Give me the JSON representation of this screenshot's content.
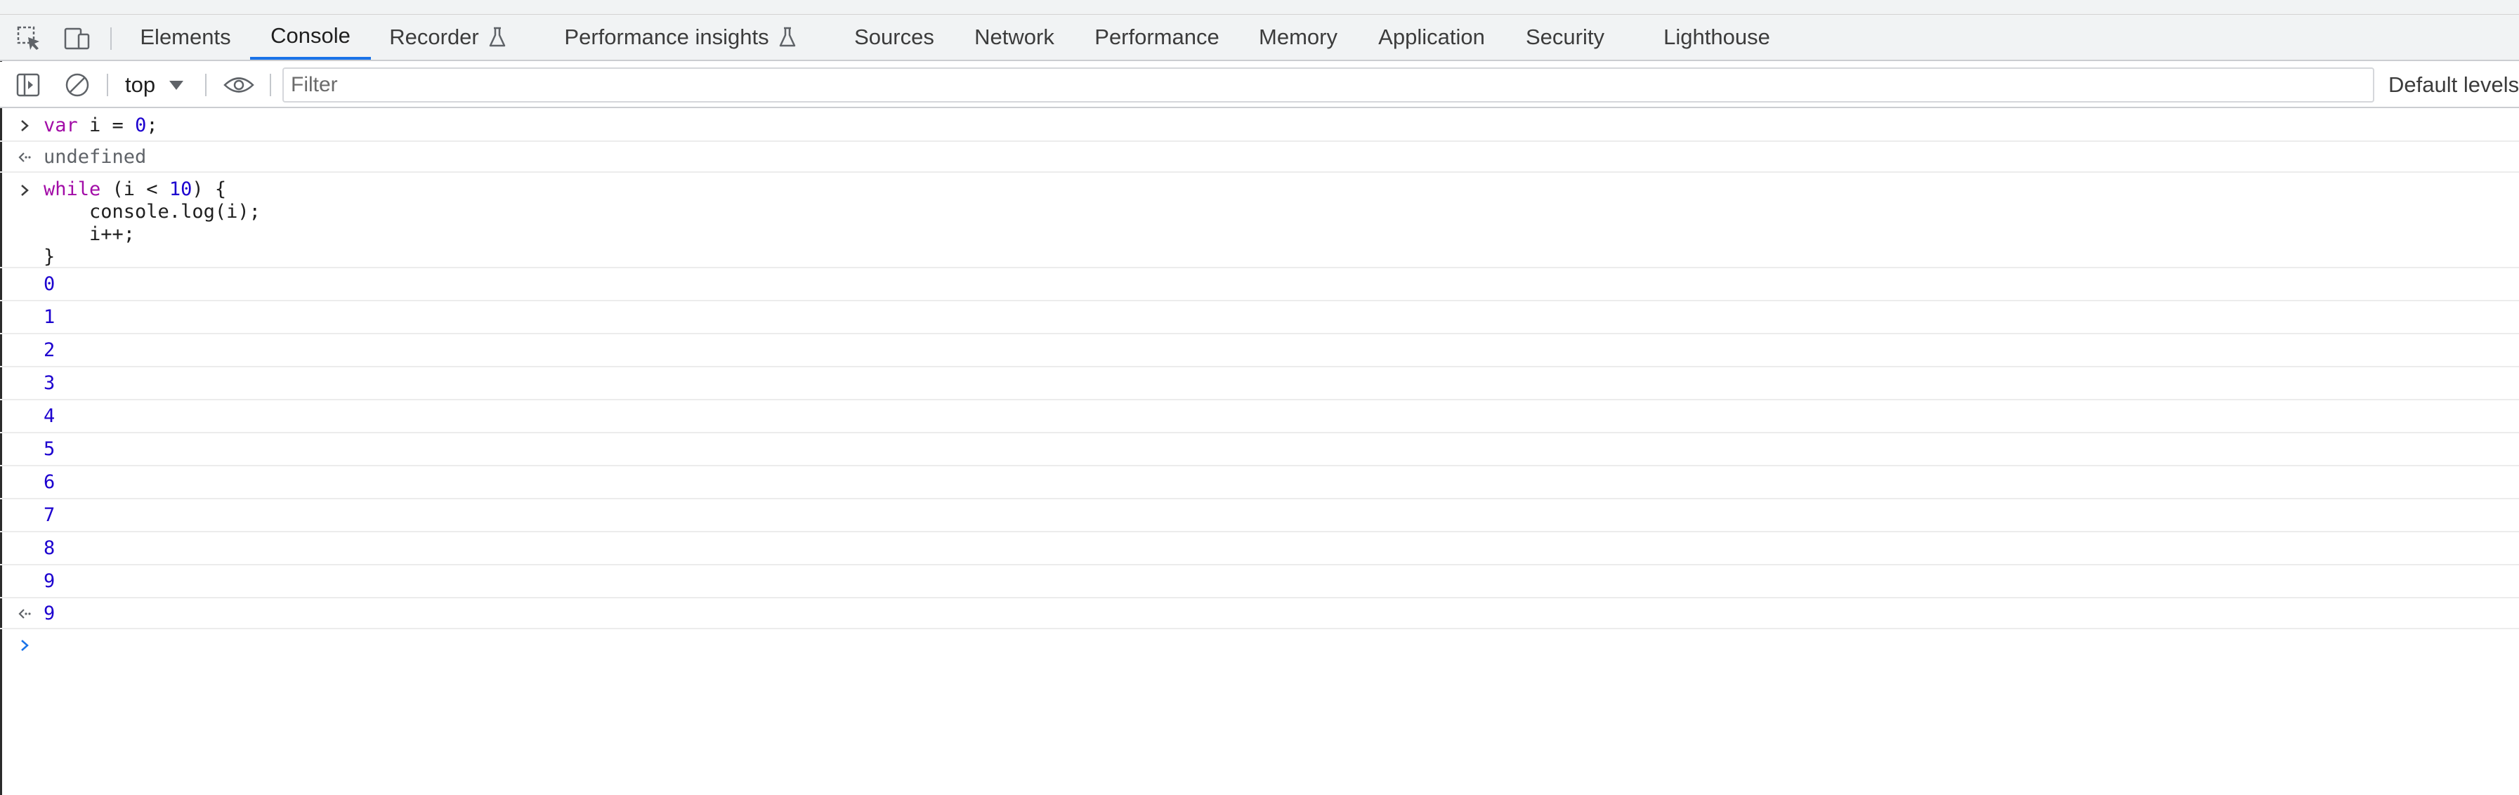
{
  "tabs": [
    {
      "label": "Elements",
      "active": false,
      "experimental": false
    },
    {
      "label": "Console",
      "active": true,
      "experimental": false
    },
    {
      "label": "Recorder",
      "active": false,
      "experimental": true
    },
    {
      "label": "Performance insights",
      "active": false,
      "experimental": true
    },
    {
      "label": "Sources",
      "active": false,
      "experimental": false
    },
    {
      "label": "Network",
      "active": false,
      "experimental": false
    },
    {
      "label": "Performance",
      "active": false,
      "experimental": false
    },
    {
      "label": "Memory",
      "active": false,
      "experimental": false
    },
    {
      "label": "Application",
      "active": false,
      "experimental": false
    },
    {
      "label": "Security",
      "active": false,
      "experimental": false
    },
    {
      "label": "Lighthouse",
      "active": false,
      "experimental": false
    }
  ],
  "toolbar": {
    "context": "top",
    "filter_placeholder": "Filter",
    "filter_value": "",
    "levels_label": "Default levels"
  },
  "console": {
    "input1": {
      "kw": "var",
      "mid": " i = ",
      "num": "0",
      "end": ";"
    },
    "result1": "undefined",
    "input2": {
      "kw": "while",
      "mid": " (i < ",
      "num": "10",
      "end": ") {",
      "body_line1": "    console.log(i);",
      "body_line2": "    i++;",
      "close": "}"
    },
    "logs": [
      "0",
      "1",
      "2",
      "3",
      "4",
      "5",
      "6",
      "7",
      "8",
      "9"
    ],
    "result2": "9"
  },
  "icons": [
    "inspect-element-icon",
    "device-toolbar-icon",
    "flask-icon",
    "sidebar-toggle-icon",
    "clear-console-icon",
    "caret-down-icon",
    "eye-icon",
    "input-chevron-icon",
    "result-arrow-icon",
    "prompt-chevron-icon"
  ],
  "colors": {
    "active_tab_underline": "#1a73e8",
    "keyword": "#a20ca7",
    "number": "#1c00cf",
    "result_text": "#5f6368",
    "prompt": "#1a73e8"
  }
}
